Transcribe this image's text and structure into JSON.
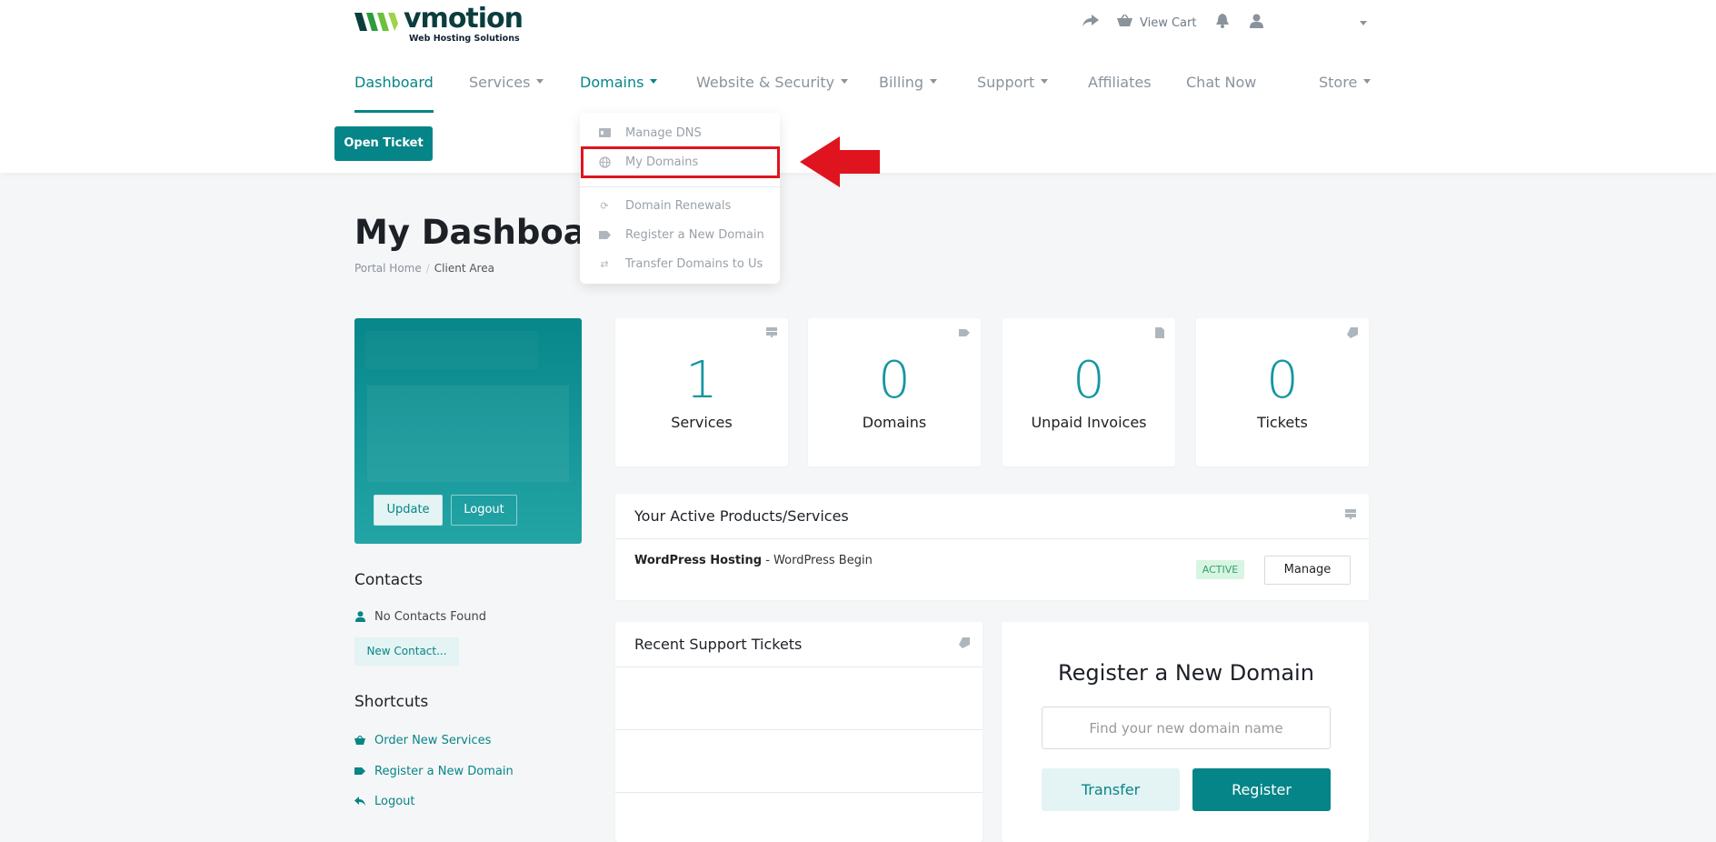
{
  "brand": {
    "name": "vmotion",
    "tagline": "Web Hosting Solutions",
    "accent": "#068588"
  },
  "top_util": {
    "share_icon": "share-arrow-icon",
    "cart_label": "View Cart",
    "bell_icon": "bell-icon",
    "user_icon": "user-icon"
  },
  "nav": {
    "items": [
      {
        "label": "Dashboard",
        "active": true
      },
      {
        "label": "Services"
      },
      {
        "label": "Domains",
        "open": true
      },
      {
        "label": "Website & Security"
      },
      {
        "label": "Billing"
      },
      {
        "label": "Support"
      },
      {
        "label": "Affiliates"
      },
      {
        "label": "Chat Now"
      },
      {
        "label": "Store"
      }
    ]
  },
  "buttons": {
    "open_ticket": "Open Ticket"
  },
  "domains_menu": {
    "items": [
      {
        "label": "Manage DNS",
        "icon": "dns-icon"
      },
      {
        "label": "My Domains",
        "icon": "globe-icon",
        "highlighted": true
      },
      {
        "label": "Domain Renewals",
        "icon": "refresh-icon"
      },
      {
        "label": "Register a New Domain",
        "icon": "tag-icon"
      },
      {
        "label": "Transfer Domains to Us",
        "icon": "transfer-icon"
      }
    ]
  },
  "page": {
    "title": "My Dashboard",
    "breadcrumb": {
      "home": "Portal Home",
      "separator": "/",
      "current": "Client Area"
    }
  },
  "profile": {
    "update_label": "Update",
    "logout_label": "Logout"
  },
  "contacts": {
    "heading": "Contacts",
    "empty_text": "No Contacts Found",
    "new_button": "New Contact..."
  },
  "shortcuts": {
    "heading": "Shortcuts",
    "items": [
      {
        "label": "Order New Services",
        "icon": "basket-icon"
      },
      {
        "label": "Register a New Domain",
        "icon": "tag-icon"
      },
      {
        "label": "Logout",
        "icon": "reply-arrow-icon"
      }
    ]
  },
  "stats": [
    {
      "value": "1",
      "label": "Services",
      "icon": "server-icon"
    },
    {
      "value": "0",
      "label": "Domains",
      "icon": "tag-icon"
    },
    {
      "value": "0",
      "label": "Unpaid Invoices",
      "icon": "document-icon"
    },
    {
      "value": "0",
      "label": "Tickets",
      "icon": "ticket-icon"
    }
  ],
  "active_products": {
    "heading": "Your Active Products/Services",
    "item": {
      "product": "WordPress Hosting",
      "detail": "- WordPress Begin",
      "status": "ACTIVE",
      "action": "Manage"
    }
  },
  "support_tickets": {
    "heading": "Recent Support Tickets"
  },
  "register_domain": {
    "title": "Register a New Domain",
    "placeholder": "Find your new domain name",
    "transfer_label": "Transfer",
    "register_label": "Register"
  }
}
